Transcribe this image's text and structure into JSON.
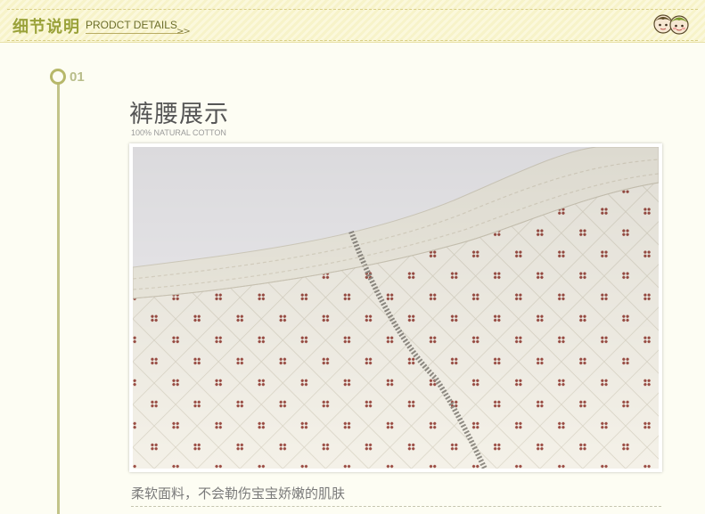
{
  "header": {
    "title_cn": "细节说明",
    "title_en": "PRODCT DETAILS",
    "chevrons": ">>"
  },
  "step": {
    "number": "01",
    "title": "裤腰展示",
    "subtitle": "100% NATURAL COTTON"
  },
  "caption": "柔软面料，不会勒伤宝宝娇嫩的肌肤",
  "colors": {
    "accent": "#9aa23a",
    "timeline": "#c2c489",
    "background": "#fdfdf3",
    "fabric": "#f3efe4",
    "dot": "#9b4c43"
  },
  "icons": {
    "kids": "two-kids-icon"
  }
}
